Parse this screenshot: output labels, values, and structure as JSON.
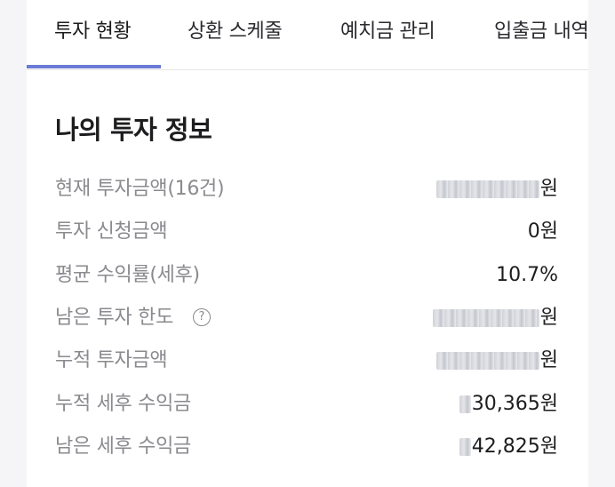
{
  "tabs": [
    {
      "label": "투자 현황",
      "active": true
    },
    {
      "label": "상환 스케줄",
      "active": false
    },
    {
      "label": "예치금 관리",
      "active": false
    },
    {
      "label": "입출금 내역",
      "active": false
    }
  ],
  "colors": {
    "accent": "#6b7bd6",
    "label": "#8a8a8f",
    "value": "#1d1d1f",
    "background": "#f5f5f7"
  },
  "investment_info": {
    "title": "나의 투자 정보",
    "rows": [
      {
        "label": "현재 투자금액(16건)",
        "value": "원",
        "masked": true
      },
      {
        "label": "투자 신청금액",
        "value": "0원",
        "masked": false
      },
      {
        "label": "평균 수익률(세후)",
        "value": "10.7%",
        "masked": false
      },
      {
        "label": "남은 투자 한도",
        "value": "원",
        "masked": true,
        "help_icon": "help-circle-icon"
      },
      {
        "label": "누적 투자금액",
        "value": "원",
        "masked": true
      },
      {
        "label": "누적 세후 수익금",
        "value": "30,365원",
        "masked": true
      },
      {
        "label": "남은 세후 수익금",
        "value": "42,825원",
        "masked": true
      }
    ]
  }
}
